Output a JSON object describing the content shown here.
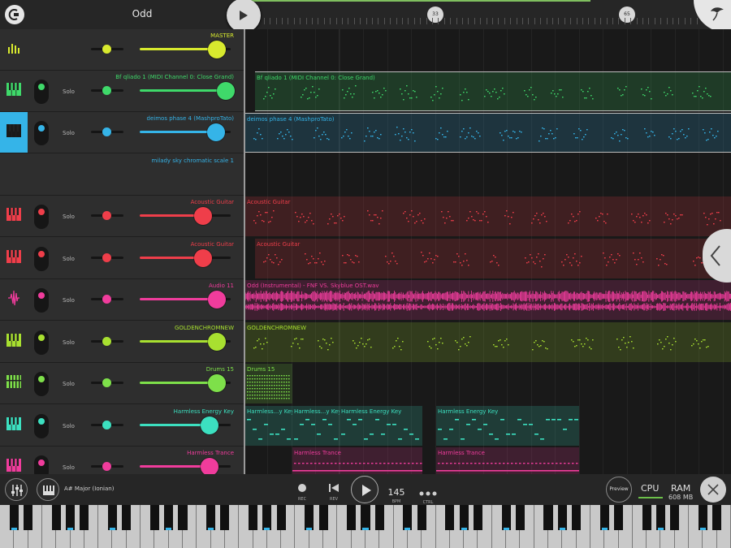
{
  "header": {
    "song_title": "Odd",
    "bar_markers": [
      "33",
      "65"
    ]
  },
  "tracks": [
    {
      "name": "MASTER",
      "color": "#d8ea2e",
      "icon": "master-meter-icon",
      "has_toggle": false,
      "solo": "",
      "volume": 0.85
    },
    {
      "name": "Bf qliado 1 (MIDI Channel 0: Close Grand)",
      "color": "#3fd96a",
      "icon": "piano-icon",
      "has_toggle": true,
      "solo": "Solo",
      "volume": 0.95
    },
    {
      "name": "deimos phase 4 (MashproTato)",
      "color": "#35b4e8",
      "icon": "piano-icon",
      "has_toggle": true,
      "solo": "Solo",
      "volume": 0.84,
      "selected": true
    },
    {
      "name": "milady sky chromatic scale 1",
      "color": "#35b4e8",
      "icon": "",
      "has_toggle": false,
      "solo": "",
      "volume": null
    },
    {
      "name": "Acoustic Guitar",
      "color": "#ef3e4a",
      "icon": "piano-icon",
      "has_toggle": true,
      "solo": "Solo",
      "volume": 0.7
    },
    {
      "name": "Acoustic Guitar",
      "color": "#ef3e4a",
      "icon": "piano-icon",
      "has_toggle": true,
      "solo": "Solo",
      "volume": 0.7
    },
    {
      "name": "Audio 11",
      "color": "#f03c9c",
      "icon": "waveform-icon",
      "has_toggle": true,
      "solo": "Solo",
      "volume": 0.85
    },
    {
      "name": "GOLDENCHROMNEW",
      "color": "#a8e030",
      "icon": "piano-icon",
      "has_toggle": true,
      "solo": "Solo",
      "volume": 0.85
    },
    {
      "name": "Drums 15",
      "color": "#7ee04a",
      "icon": "drum-pads-icon",
      "has_toggle": true,
      "solo": "Solo",
      "volume": 0.85
    },
    {
      "name": "Harmless Energy Key",
      "color": "#3ce0c0",
      "icon": "piano-icon",
      "has_toggle": true,
      "solo": "Solo",
      "volume": 0.77
    },
    {
      "name": "Harmless Trance",
      "color": "#f03c9c",
      "icon": "piano-icon",
      "has_toggle": true,
      "solo": "Solo",
      "volume": 0.77
    }
  ],
  "clips": [
    {
      "label": "Bf qliado 1 (MIDI Channel 0: Close Grand)",
      "color": "#3fd96a",
      "track": 1
    },
    {
      "label": "deimos phase 4 (MashproTato)",
      "color": "#35b4e8",
      "track": 2
    },
    {
      "label": "Acoustic Guitar",
      "color": "#ef3e4a",
      "track": 4
    },
    {
      "label": "Acoustic Guitar",
      "color": "#ef3e4a",
      "track": 5
    },
    {
      "label": "Odd (Instrumental) - FNF VS. Skyblue OST.wav",
      "color": "#f03c9c",
      "track": 6
    },
    {
      "label": "GOLDENCHROMNEW",
      "color": "#a8e030",
      "track": 7
    },
    {
      "label": "Drums 15",
      "color": "#7ee04a",
      "track": 8
    },
    {
      "label": "Harmless...y Key",
      "color": "#3ce0c0",
      "track": 9
    },
    {
      "label": "Harmless...y Key",
      "color": "#3ce0c0",
      "track": 9
    },
    {
      "label": "Harmless Energy Key",
      "color": "#3ce0c0",
      "track": 9
    },
    {
      "label": "Harmless Energy Key",
      "color": "#3ce0c0",
      "track": 9
    },
    {
      "label": "Harmless Trance",
      "color": "#f03c9c",
      "track": 10
    },
    {
      "label": "Harmless Trance",
      "color": "#f03c9c",
      "track": 10
    }
  ],
  "bottom": {
    "scale": "A# Major (Ionian)",
    "rec_label": "REC",
    "rev_label": "REV",
    "bpm": "145",
    "bpm_label": "BPM",
    "ctrl_label": "CTRL",
    "preview": "Preview",
    "cpu": "CPU",
    "ram": "RAM",
    "ram_value": "608 MB"
  },
  "colors": {
    "accent": "#35b4e8",
    "panel": "#2e2e2e",
    "timeline": "#191919"
  }
}
